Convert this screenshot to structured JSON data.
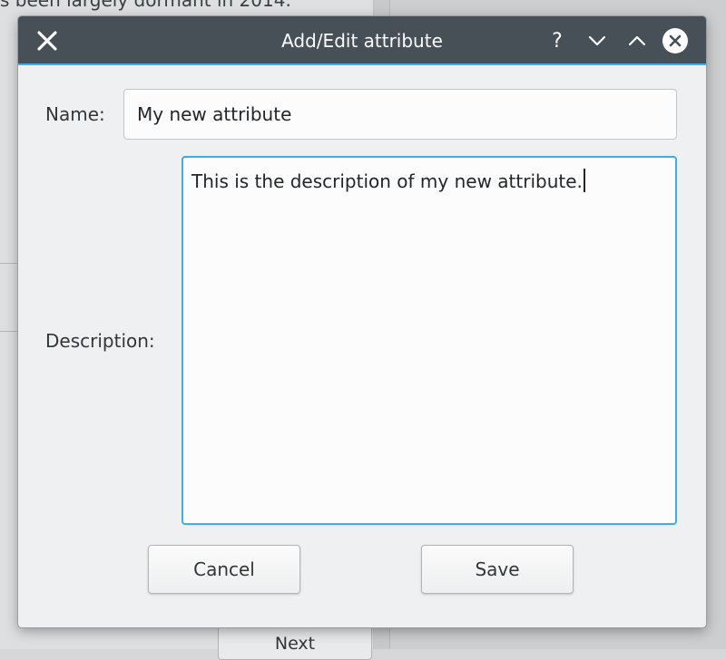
{
  "background": {
    "text": "s been largely dormant in 2014.",
    "next_label": "Next"
  },
  "dialog": {
    "title": "Add/Edit attribute",
    "titlebar_buttons": {
      "app_icon": "close-x-icon",
      "help": "?",
      "minimize": "chevron-down-icon",
      "maximize": "chevron-up-icon",
      "close": "close-circle-icon"
    },
    "name_label": "Name:",
    "name_value": "My new attribute",
    "description_label": "Description:",
    "description_value": "This is the description of my new attribute.",
    "cancel_label": "Cancel",
    "save_label": "Save"
  },
  "colors": {
    "titlebar": "#475057",
    "accent": "#3daee9",
    "window_bg": "#eff0f1"
  }
}
